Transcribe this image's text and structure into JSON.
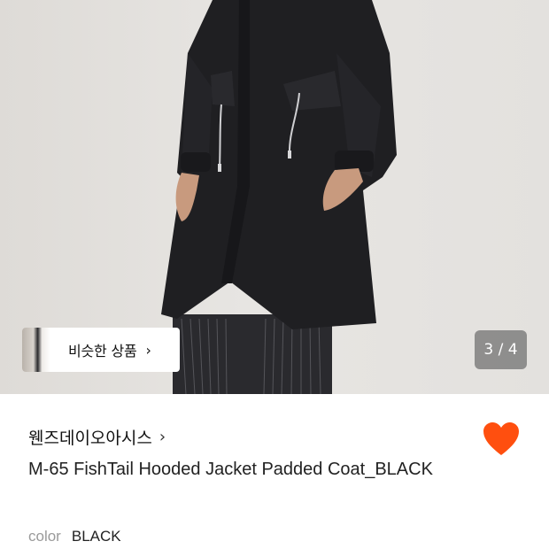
{
  "product_image": {
    "counter": "3 / 4"
  },
  "similar": {
    "label": "비슷한 상품",
    "arrow": "›"
  },
  "brand": {
    "name": "웬즈데이오아시스",
    "arrow": "›"
  },
  "product": {
    "title": "M-65 FishTail Hooded Jacket Padded Coat_BLACK"
  },
  "option": {
    "label": "color",
    "value": "BLACK"
  },
  "colors": {
    "wishlist": "#FF4F0F",
    "coat": "#1f1f22",
    "pants": "#2a2a2e"
  },
  "icons": {
    "wishlist": "heart-icon",
    "similar_arrow": "chevron-right-icon",
    "brand_arrow": "chevron-right-icon"
  }
}
